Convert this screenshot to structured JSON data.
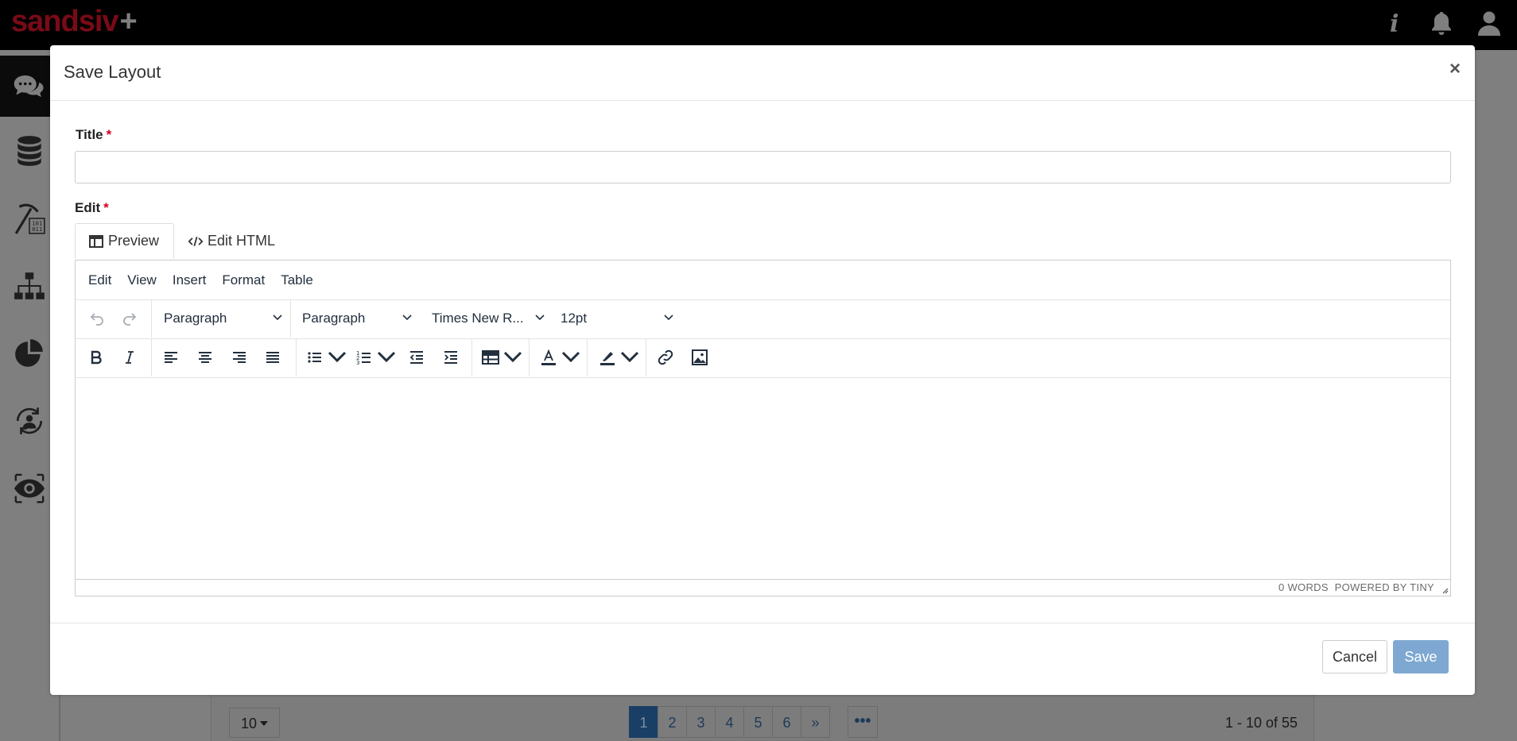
{
  "app": {
    "logo_text": "sandsiv",
    "logo_plus": "+",
    "brand_color": "#7a0a17",
    "top_icons": [
      "info-icon",
      "bell-icon",
      "user-icon"
    ],
    "sidebar_icons": [
      "chat-icon",
      "database-icon",
      "data-mining-icon",
      "hierarchy-icon",
      "pie-chart-icon",
      "sync-user-icon",
      "eye-icon"
    ]
  },
  "background_table": {
    "page_size": "10",
    "pages": [
      "1",
      "2",
      "3",
      "4",
      "5",
      "6",
      "»"
    ],
    "active_page": "1",
    "more": "•••",
    "range_text": "1 - 10 of 55"
  },
  "modal": {
    "title": "Save Layout",
    "close": "×",
    "title_label": "Title",
    "required_mark": "*",
    "title_value": "",
    "edit_label": "Edit",
    "tabs": [
      {
        "label": "Preview",
        "icon": "layout-icon",
        "active": true
      },
      {
        "label": "Edit HTML",
        "icon": "code-icon",
        "active": false
      }
    ],
    "editor": {
      "menu": [
        "Edit",
        "View",
        "Insert",
        "Format",
        "Table"
      ],
      "block_format_1": "Paragraph",
      "block_format_2": "Paragraph",
      "font_family": "Times New R...",
      "font_size": "12pt",
      "status": "0 WORDS  POWERED BY TINY"
    },
    "cancel_label": "Cancel",
    "save_label": "Save"
  }
}
